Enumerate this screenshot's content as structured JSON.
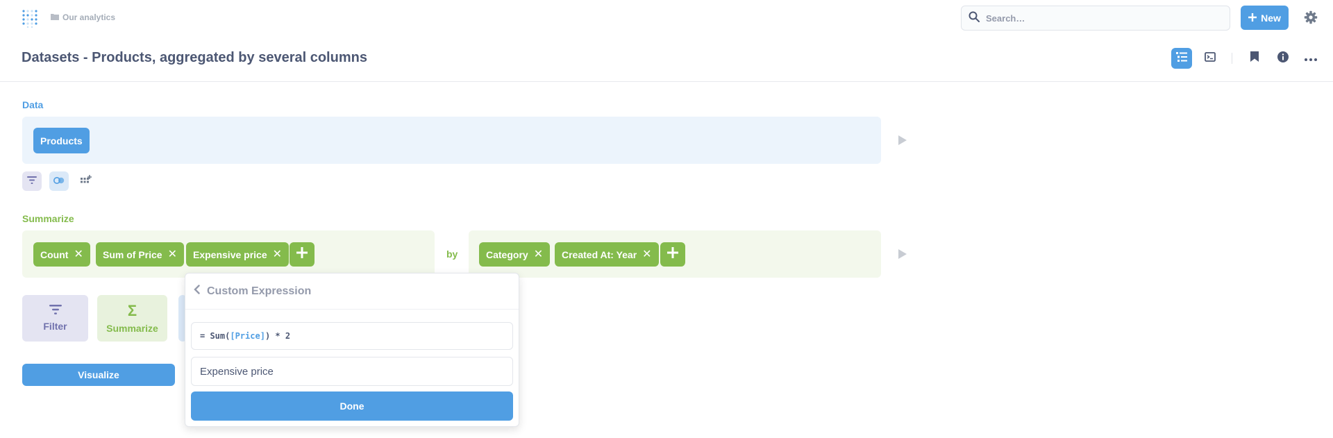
{
  "topbar": {
    "breadcrumb": "Our analytics",
    "search_placeholder": "Search…",
    "new_label": "New"
  },
  "header": {
    "title": "Datasets - Products, aggregated by several columns"
  },
  "notebook": {
    "data_label": "Data",
    "source_table": "Products",
    "summarize_label": "Summarize",
    "metrics": [
      "Count",
      "Sum of Price",
      "Expensive price"
    ],
    "by_label": "by",
    "breakouts": [
      "Category",
      "Created At: Year"
    ],
    "actions": {
      "filter": "Filter",
      "summarize": "Summarize"
    },
    "visualize_label": "Visualize"
  },
  "popover": {
    "title": "Custom Expression",
    "expression_prefix": "= Sum(",
    "expression_ref": "[Price]",
    "expression_suffix": ") * 2",
    "name_value": "Expensive price",
    "done_label": "Done"
  },
  "colors": {
    "brand": "#509ee3",
    "summarize": "#84bb4c",
    "filter": "#7172ad",
    "text": "#4c5773"
  }
}
